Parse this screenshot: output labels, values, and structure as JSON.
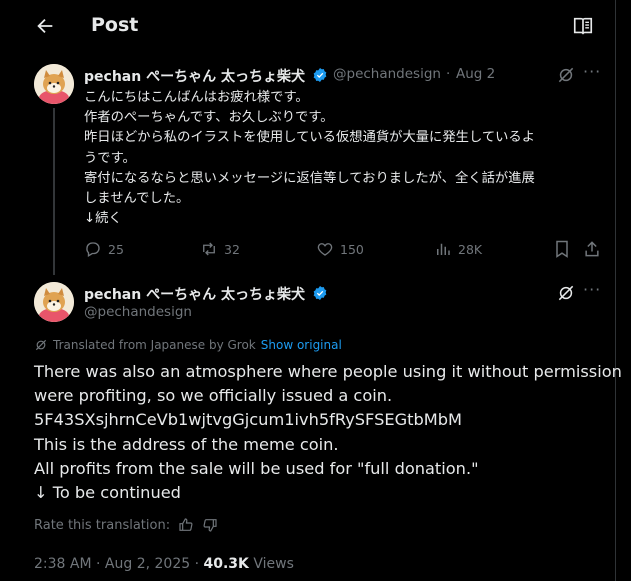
{
  "header": {
    "title": "Post",
    "back_icon": "arrow-left-icon",
    "reader_icon": "reader-book-icon"
  },
  "reply_tweet": {
    "display_name": "pechan ぺーちゃん 太っちょ柴犬",
    "handle": "@pechandesign",
    "separator": "·",
    "date": "Aug 2",
    "lines": [
      "こんにちはこんばんはお疲れ様です。",
      "作者のぺーちゃんです、お久しぶりです。",
      "昨日ほどから私のイラストを使用している仮想通貨が大量に発生しているよ",
      "うです。",
      "寄付になるならと思いメッセージに返信等しておりましたが、全く話が進展",
      "しませんでした。",
      "↓続く"
    ],
    "actions": {
      "replies": "25",
      "reposts": "32",
      "likes": "150",
      "views": "28K"
    }
  },
  "main_tweet": {
    "display_name": "pechan ぺーちゃん 太っちょ柴犬",
    "handle": "@pechandesign",
    "translated_label": "Translated from Japanese by Grok",
    "show_original": "Show original",
    "lines": [
      "There was also an atmosphere where people using it without permission",
      "were profiting, so we officially issued a coin.",
      "5F43SXsjhrnCeVb1wjtvgGjcum1ivh5fRySFSEGtbMbM",
      "This is the address of the meme coin.",
      "All profits from the sale will be used for \"full donation.\"",
      "↓ To be continued"
    ],
    "rate_label": "Rate this translation:",
    "time": "2:38 AM",
    "sep": "·",
    "full_date": "Aug 2, 2025",
    "sep2": "·",
    "views_count": "40.3K",
    "views_label": "Views"
  },
  "colors": {
    "background": "#000000",
    "text": "#e7e9ea",
    "muted": "#71767b",
    "accent": "#1d9bf0",
    "verified": "#1d9bf0"
  }
}
